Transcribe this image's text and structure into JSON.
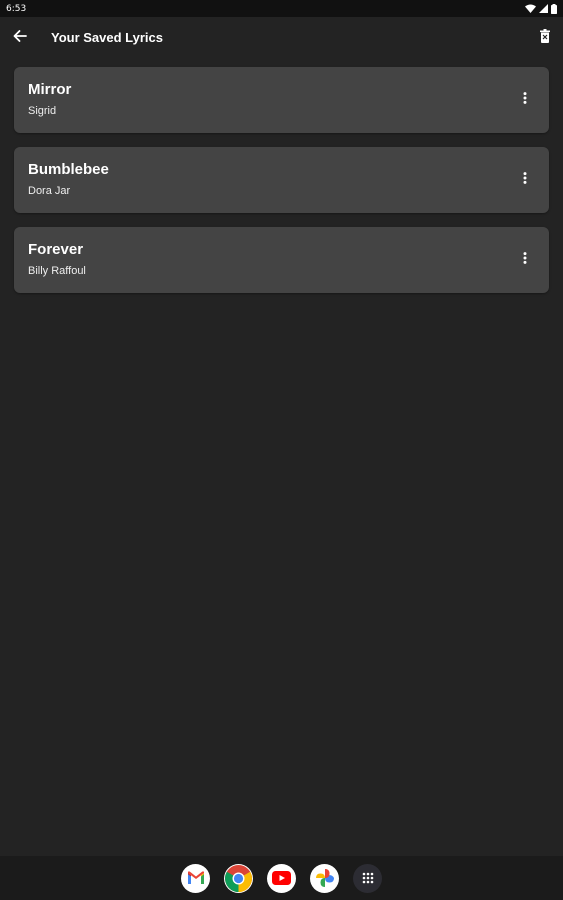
{
  "status_bar": {
    "time": "6:53",
    "icons": [
      "wifi-icon",
      "signal-icon",
      "battery-icon"
    ]
  },
  "app_bar": {
    "title": "Your Saved Lyrics",
    "back_icon": "arrow-back-icon",
    "delete_icon": "trash-icon"
  },
  "lyrics": [
    {
      "title": "Mirror",
      "artist": "Sigrid"
    },
    {
      "title": "Bumblebee",
      "artist": "Dora Jar"
    },
    {
      "title": "Forever",
      "artist": "Billy Raffoul"
    }
  ],
  "dock": {
    "apps": [
      "gmail-icon",
      "chrome-icon",
      "youtube-icon",
      "photos-icon",
      "app-drawer-icon"
    ]
  },
  "colors": {
    "background": "#232323",
    "card": "#444444",
    "status_bar": "#111111",
    "dock": "#1b1b1b",
    "text": "#ffffff"
  }
}
